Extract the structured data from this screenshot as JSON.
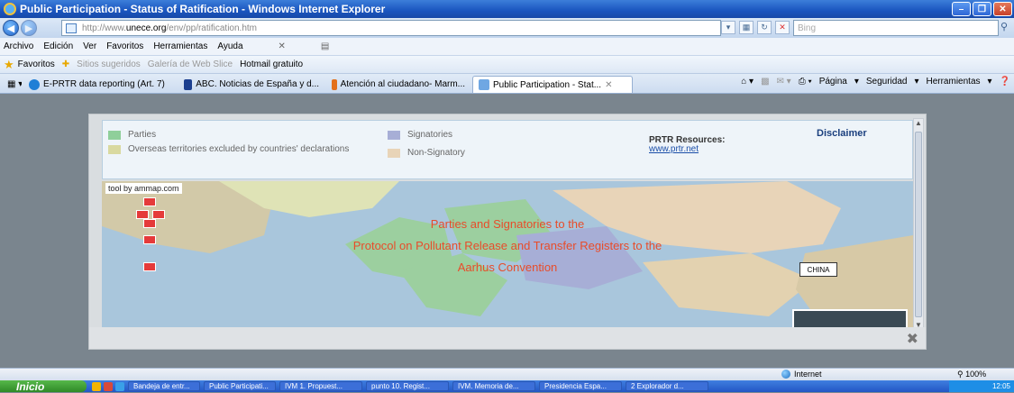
{
  "window": {
    "title": "Public Participation - Status of Ratification - Windows Internet Explorer"
  },
  "address_bar": {
    "url_prefix": "http://www.",
    "url_domain": "unece.org",
    "url_path": "/env/pp/ratification.htm",
    "search_placeholder": "Bing"
  },
  "menu": {
    "items": [
      "Archivo",
      "Edición",
      "Ver",
      "Favoritos",
      "Herramientas",
      "Ayuda"
    ]
  },
  "favorites_bar": {
    "favorites_label": "Favoritos",
    "items": [
      "Sitios sugeridos",
      "Galería de Web Slice",
      "Hotmail gratuito"
    ]
  },
  "tabs": {
    "items": [
      {
        "label": "E-PRTR data reporting (Art. 7)"
      },
      {
        "label": "ABC. Noticias de España y d..."
      },
      {
        "label": "Atención al ciudadano- Marm..."
      },
      {
        "label": "Public Participation - Stat..."
      }
    ],
    "commands": [
      "Página",
      "Seguridad",
      "Herramientas"
    ]
  },
  "page": {
    "legend": {
      "parties": "Parties",
      "overseas": "Overseas territories excluded by countries' declarations",
      "signatories": "Signatories",
      "non_signatory": "Non-Signatory",
      "colors": {
        "parties": "#8fcf9a",
        "overseas": "#d9d9a0",
        "signatories": "#a7aed6",
        "non_signatory": "#e8d4b8"
      }
    },
    "resources_title": "PRTR Resources:",
    "resources_link": "www.prtr.net",
    "disclaimer": "Disclaimer",
    "map": {
      "credit": "tool by ammap.com",
      "title_line1": "Parties and Signatories to the",
      "title_line2": "Protocol on Pollutant Release and Transfer Registers to the",
      "title_line3": "Aarhus Convention",
      "china_label": "CHINA"
    }
  },
  "status": {
    "zone": "Internet",
    "zoom": "100%"
  },
  "taskbar": {
    "start_label": "Inicio",
    "tasks": [
      "Bandeja de entr...",
      "Public Participati...",
      "IVM 1. Propuest...",
      "punto 10. Regist...",
      "IVM. Memoria de...",
      "Presidencia Espa...",
      "2 Explorador d..."
    ],
    "clock": "12:05"
  }
}
